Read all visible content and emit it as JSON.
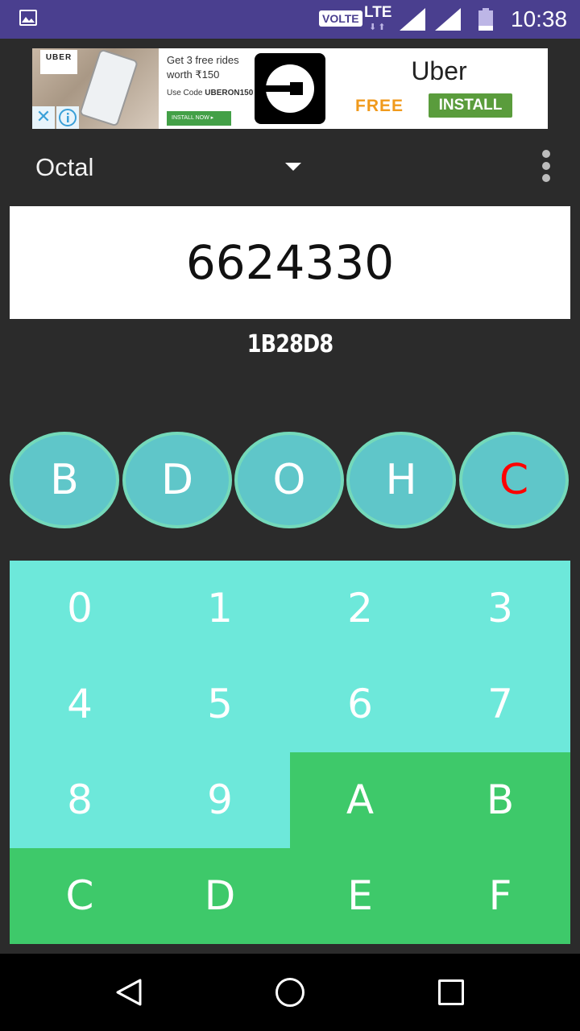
{
  "status_bar": {
    "volte": "VOLTE",
    "network": "LTE",
    "time": "10:38",
    "icons": [
      "gallery-icon",
      "signal-icon",
      "signal-icon",
      "battery-icon"
    ]
  },
  "ad": {
    "photo_tag": "UBER",
    "headline": "Get 3 free rides worth ₹150",
    "code_prefix": "Use Code ",
    "code": "UBERON150",
    "install_small": "INSTALL NOW",
    "brand": "Uber",
    "price": "FREE",
    "install": "INSTALL",
    "close_symbol": "✕"
  },
  "toolbar": {
    "mode": "Octal"
  },
  "display": {
    "value": "6624330",
    "converted": "1B28D8"
  },
  "base_buttons": [
    {
      "label": "B",
      "color": "#ffffff"
    },
    {
      "label": "D",
      "color": "#ffffff"
    },
    {
      "label": "O",
      "color": "#ffffff"
    },
    {
      "label": "H",
      "color": "#ffffff"
    },
    {
      "label": "C",
      "color": "#ff0000"
    }
  ],
  "keypad": {
    "keys": [
      "0",
      "1",
      "2",
      "3",
      "4",
      "5",
      "6",
      "7",
      "8",
      "9",
      "A",
      "B",
      "C",
      "D",
      "E",
      "F"
    ],
    "teal_color": "#6de8da",
    "green_color": "#3ec96a"
  }
}
